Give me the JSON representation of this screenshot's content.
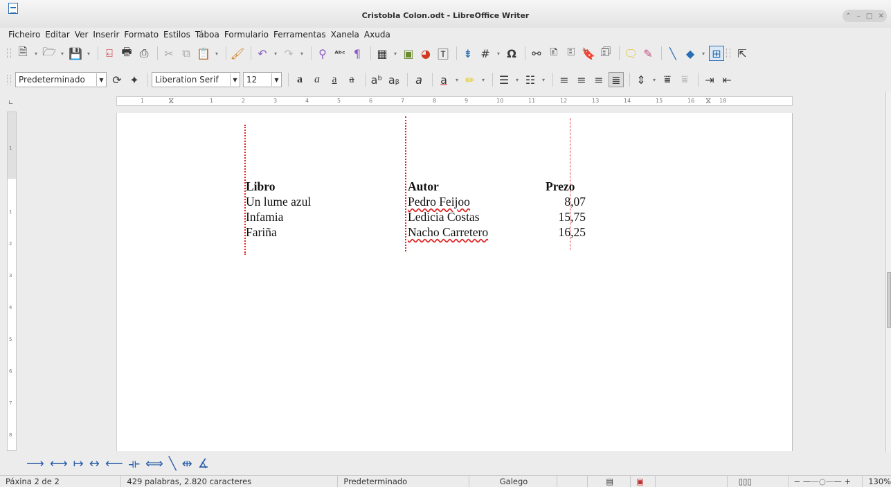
{
  "window": {
    "title": "Cristobla Colon.odt - LibreOffice Writer"
  },
  "menu": [
    "Ficheiro",
    "Editar",
    "Ver",
    "Inserir",
    "Formato",
    "Estilos",
    "Táboa",
    "Formulario",
    "Ferramentas",
    "Xanela",
    "Axuda"
  ],
  "format_bar": {
    "paragraph_style": "Predeterminado",
    "font_name": "Liberation Serif",
    "font_size": "12"
  },
  "ruler": {
    "ticks": [
      "1",
      "1",
      "2",
      "3",
      "4",
      "5",
      "6",
      "7",
      "8",
      "9",
      "10",
      "11",
      "12",
      "13",
      "14",
      "15",
      "16",
      "17",
      "18"
    ]
  },
  "document": {
    "headers": [
      "Libro",
      "Autor",
      "Prezo"
    ],
    "rows": [
      [
        "Un lume azul",
        "Pedro Feijoo",
        "8,07"
      ],
      [
        "Infamia",
        "Ledicia Costas",
        "15,75"
      ],
      [
        "Fariña",
        "Nacho Carretero",
        "16,25"
      ]
    ]
  },
  "status": {
    "page": "Páxina 2 de 2",
    "words": "429 palabras, 2.820 caracteres",
    "style": "Predeterminado",
    "language": "Galego",
    "zoom": "130%"
  }
}
